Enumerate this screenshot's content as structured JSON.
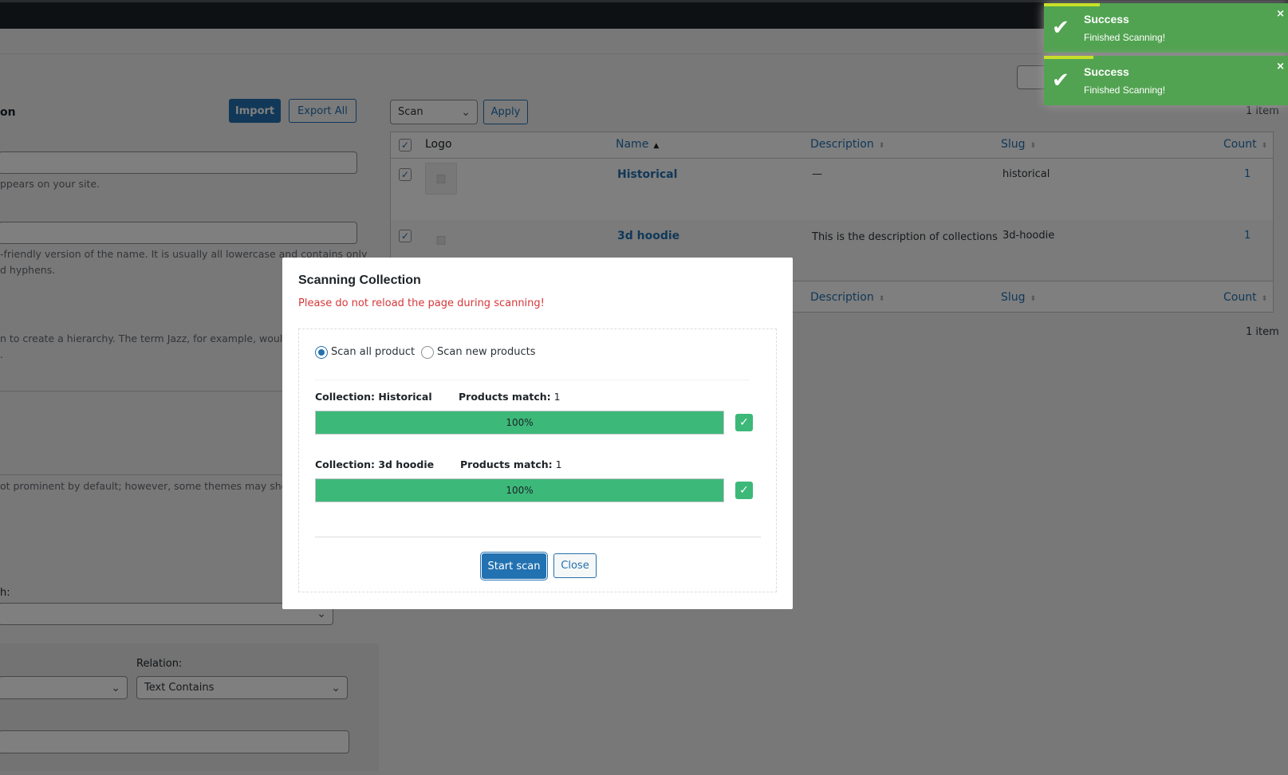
{
  "left_form": {
    "heading": "on",
    "import_label": "Import",
    "export_label": "Export All",
    "name_hint": "ppears on your site.",
    "slug_hint_1": "-friendly version of the name. It is usually all lowercase and contains only",
    "slug_hint_2": "d hyphens.",
    "parent_hint_1": "n to create a hierarchy. The term Jazz, for example, would be",
    "parent_hint_2": ".",
    "description_hint": "ot prominent by default; however, some themes may show it.",
    "match_label": "h:",
    "relation_label": "Relation:",
    "relation_value": "Text Contains"
  },
  "bulk": {
    "action_value": "Scan",
    "apply_label": "Apply",
    "item_count_top": "1 item",
    "item_count_bottom": "1 item"
  },
  "table": {
    "headers": {
      "logo": "Logo",
      "name": "Name",
      "description": "Description",
      "slug": "Slug",
      "count": "Count"
    },
    "rows": [
      {
        "name": "Historical",
        "description": "—",
        "slug": "historical",
        "count": "1"
      },
      {
        "name": "3d hoodie",
        "description": "This is the description of collections",
        "slug": "3d-hoodie",
        "count": "1"
      }
    ]
  },
  "modal": {
    "title": "Scanning Collection",
    "warning": "Please do not reload the page during scanning!",
    "radio_all": "Scan all product",
    "radio_new": "Scan new products",
    "collections": [
      {
        "label": "Collection: Historical",
        "match_label": "Products match:",
        "match_value": "1",
        "progress": 100,
        "progress_text": "100%"
      },
      {
        "label": "Collection: 3d hoodie",
        "match_label": "Products match:",
        "match_value": "1",
        "progress": 100,
        "progress_text": "100%"
      }
    ],
    "start_label": "Start scan",
    "close_label": "Close"
  },
  "toasts": [
    {
      "title": "Success",
      "message": "Finished Scanning!",
      "close": "×"
    },
    {
      "title": "Success",
      "message": "Finished Scanning!",
      "close": "×"
    }
  ],
  "colors": {
    "accent": "#2271b1",
    "progress": "#3cb879",
    "toast": "#51a351",
    "warning": "#d63638"
  }
}
